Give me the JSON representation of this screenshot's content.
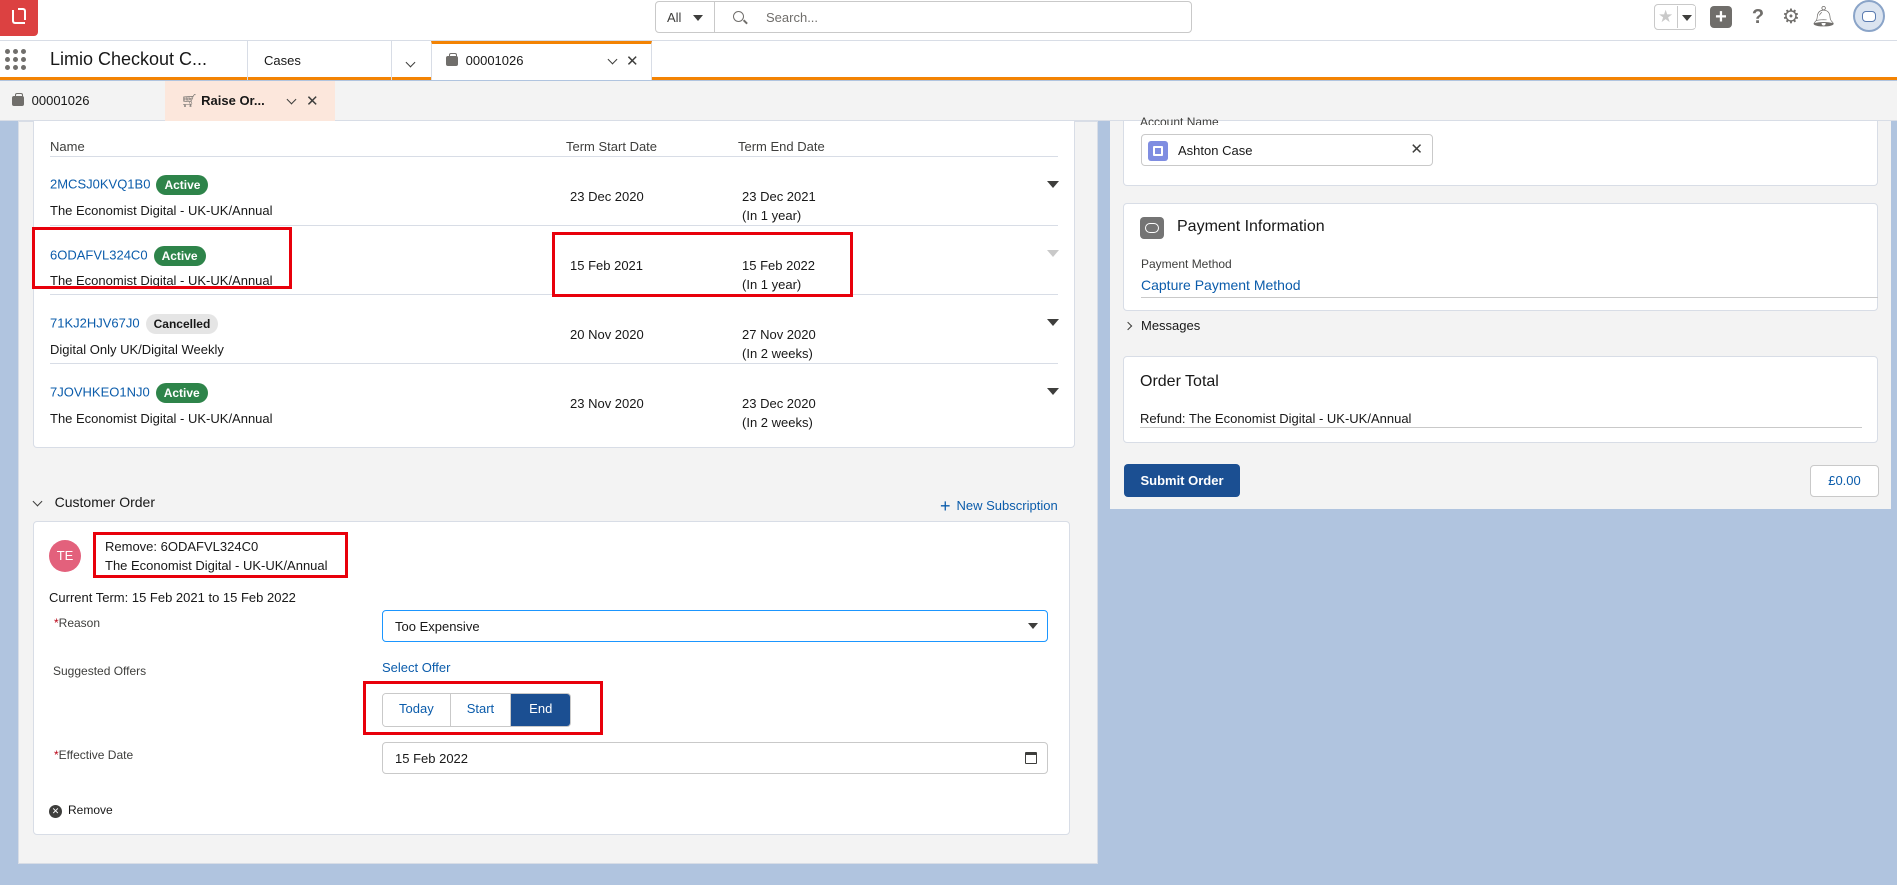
{
  "header": {
    "search_scope": "All",
    "search_placeholder": "Search..."
  },
  "nav": {
    "app_name": "Limio Checkout C...",
    "object_tab": "Cases",
    "record_tab": "00001026"
  },
  "subtabs": {
    "tab1": "00001026",
    "tab2": "Raise Or..."
  },
  "subscriptions": {
    "col_name": "Name",
    "col_start": "Term Start Date",
    "col_end": "Term End Date",
    "rows": [
      {
        "id": "2MCSJ0KVQ1B0",
        "status": "Active",
        "product": "The Economist Digital - UK-UK/Annual",
        "start": "23 Dec 2020",
        "end": "23 Dec 2021",
        "relative": "(In 1 year)"
      },
      {
        "id": "6ODAFVL324C0",
        "status": "Active",
        "product": "The Economist Digital - UK-UK/Annual",
        "start": "15 Feb 2021",
        "end": "15 Feb 2022",
        "relative": "(In 1 year)"
      },
      {
        "id": "71KJ2HJV67J0",
        "status": "Cancelled",
        "product": "Digital Only UK/Digital Weekly",
        "start": "20 Nov 2020",
        "end": "27 Nov 2020",
        "relative": "(In 2 weeks)"
      },
      {
        "id": "7JOVHKEO1NJ0",
        "status": "Active",
        "product": "The Economist Digital - UK-UK/Annual",
        "start": "23 Nov 2020",
        "end": "23 Dec 2020",
        "relative": "(In 2 weeks)"
      }
    ]
  },
  "customer_order": {
    "section_title": "Customer Order",
    "new_subscription": "New Subscription",
    "avatar_initials": "TE",
    "remove_title": "Remove: 6ODAFVL324C0",
    "remove_product": "The Economist Digital - UK-UK/Annual",
    "current_term": "Current Term: 15 Feb 2021 to 15 Feb 2022",
    "reason_label": "Reason",
    "reason_value": "Too Expensive",
    "offers_label": "Suggested Offers",
    "select_offer": "Select Offer",
    "btn_today": "Today",
    "btn_start": "Start",
    "btn_end": "End",
    "effective_label": "Effective Date",
    "effective_value": "15 Feb 2022",
    "remove_link": "Remove"
  },
  "right": {
    "account_label": "Account Name",
    "account_value": "Ashton Case",
    "payment_title": "Payment Information",
    "payment_method_label": "Payment Method",
    "payment_method_link": "Capture Payment Method",
    "messages": "Messages",
    "order_total_title": "Order Total",
    "order_line": "Refund: The Economist Digital - UK-UK/Annual",
    "submit": "Submit Order",
    "total": "£0.00"
  },
  "colors": {
    "brand": "#1b4f92",
    "link": "#0b5cab",
    "active_badge": "#2e844a",
    "highlight": "#e8000b",
    "nav_accent": "#f38303"
  }
}
